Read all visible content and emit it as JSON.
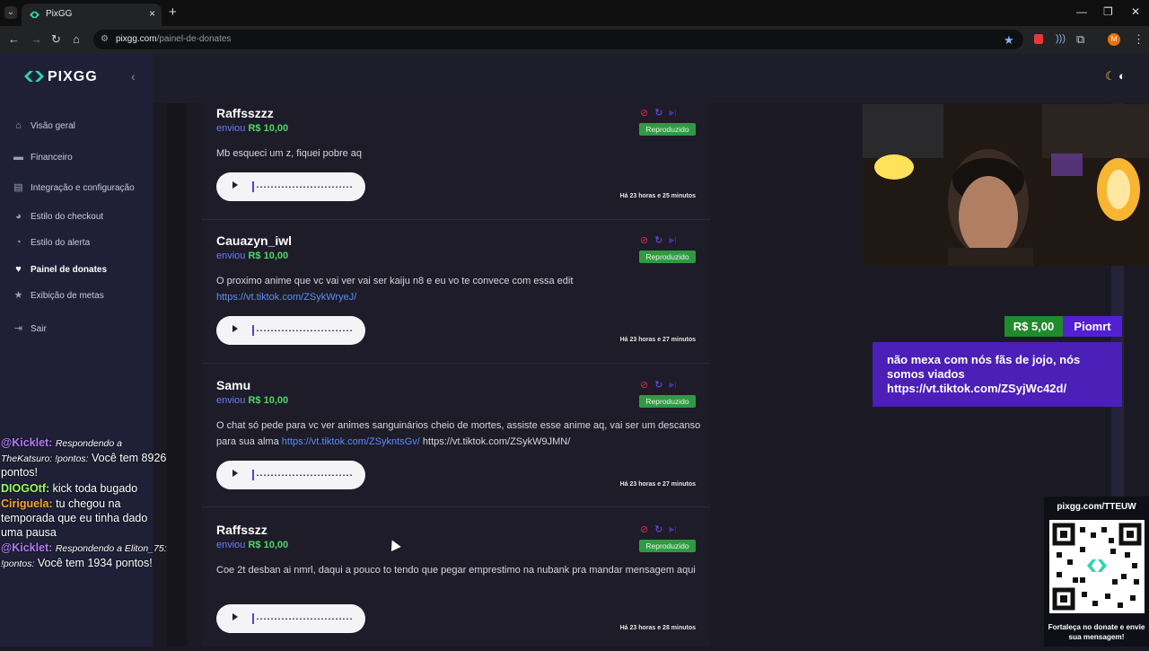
{
  "browser": {
    "tab_title": "PixGG",
    "url_host": "pixgg.com",
    "url_path": "/painel-de-donates",
    "new_tab": "+",
    "tab_close": "×"
  },
  "sidebar": {
    "logo": "PIXGG",
    "items": [
      {
        "label": "Visão geral",
        "icon": "home-icon"
      },
      {
        "label": "Financeiro",
        "icon": "wallet-icon"
      },
      {
        "label": "Integração e configuração",
        "icon": "settings-icon"
      },
      {
        "label": "Estilo do checkout",
        "icon": "palette-icon"
      },
      {
        "label": "Estilo do alerta",
        "icon": "palette-icon"
      },
      {
        "label": "Painel de donates",
        "icon": "donate-icon"
      },
      {
        "label": "Exibição de metas",
        "icon": "star-icon"
      },
      {
        "label": "Sair",
        "icon": "logout-icon"
      }
    ]
  },
  "chat": [
    {
      "user": "@Kicklet:",
      "reply": "Respondendo a TheKatsuro: !pontos:",
      "text": "Você tem 8926 pontos!"
    },
    {
      "user": "DIOGOtf:",
      "text": "kick toda bugado"
    },
    {
      "user": "Ciriguela:",
      "text": "tu chegou na temporada que eu tinha dado uma pausa"
    },
    {
      "user": "@Kicklet:",
      "reply": "Respondendo a Eliton_75: !pontos:",
      "text": "Você tem 1934 pontos!"
    }
  ],
  "donations": [
    {
      "name": "Raffsszzz",
      "sent_word": "enviou",
      "amount": "R$ 10,00",
      "status": "Reproduzido",
      "message": "Mb esqueci um z, fiquei pobre aq",
      "link": "",
      "extra": "",
      "time": "Há 23 horas e 25 minutos"
    },
    {
      "name": "Cauazyn_iwl",
      "sent_word": "enviou",
      "amount": "R$ 10,00",
      "status": "Reproduzido",
      "message": "O proximo anime que vc vai ver vai ser kaiju n8 e eu vo te convece com essa edit",
      "link": "https://vt.tiktok.com/ZSykWryeJ/",
      "extra": "",
      "time": "Há 23 horas e 27 minutos"
    },
    {
      "name": "Samu",
      "sent_word": "enviou",
      "amount": "R$ 10,00",
      "status": "Reproduzido",
      "message": "O chat só pede para vc ver animes sanguinários cheio de mortes, assiste esse anime aq, vai ser um descanso para sua alma",
      "link": "https://vt.tiktok.com/ZSykntsGv/",
      "extra": "https://vt.tiktok.com/ZSykW9JMN/",
      "time": "Há 23 horas e 27 minutos"
    },
    {
      "name": "Raffsszz",
      "sent_word": "enviou",
      "amount": "R$ 10,00",
      "status": "Reproduzido",
      "message": "Coe 2t desban ai nmrl, daqui a pouco to tendo que pegar emprestimo na nubank pra mandar mensagem aqui",
      "link": "",
      "extra": "",
      "time": "Há 23 horas e 28 minutos"
    }
  ],
  "alert": {
    "amount": "R$ 5,00",
    "user": "Piomrt",
    "message": "não mexa com nós fãs de jojo, nós somos viados https://vt.tiktok.com/ZSyjWc42d/"
  },
  "qr": {
    "url": "pixgg.com/TTEUW",
    "caption": "Fortaleça no donate e envie sua mensagem!"
  }
}
